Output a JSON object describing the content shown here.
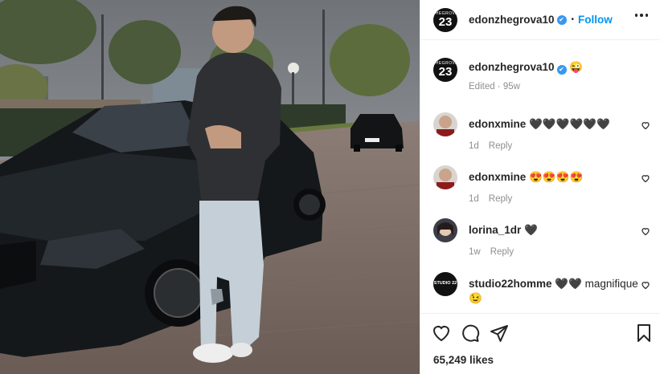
{
  "post": {
    "author": "edonzhegrova10",
    "author_logo_small": "ZHEGROVA",
    "author_logo_number": "23",
    "separator": "•",
    "follow_label": "Follow",
    "caption_emoji": "😜",
    "edited_label": "Edited",
    "age": "95w",
    "likes": "65,249 likes"
  },
  "comments": [
    {
      "user": "edonxmine",
      "text": "🖤🖤🖤🖤🖤🖤",
      "age": "1d",
      "reply_label": "Reply",
      "avatar_color": "#c9a38a"
    },
    {
      "user": "edonxmine",
      "text": "😍😍😍😍",
      "age": "1d",
      "reply_label": "Reply",
      "avatar_color": "#c9a38a"
    },
    {
      "user": "lorina_1dr",
      "text": "🖤",
      "age": "1w",
      "reply_label": "Reply",
      "avatar_color": "#5a4a55"
    },
    {
      "user": "studio22homme",
      "text": "🖤🖤 magnifique 😉",
      "avatar_label": "STUDIO 22",
      "avatar_color": "#111111"
    }
  ],
  "icons": {
    "more": "more-options-icon",
    "verified": "verified-badge-icon",
    "like": "heart-icon",
    "comment": "comment-icon",
    "share": "send-icon",
    "save": "bookmark-icon"
  },
  "colors": {
    "accent": "#0095f6",
    "verified": "#3897f0",
    "meta_text": "#8e8e8e",
    "text": "#262626"
  }
}
